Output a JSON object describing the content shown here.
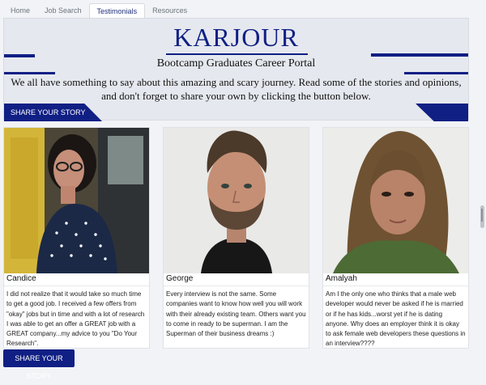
{
  "nav": {
    "tabs": [
      "Home",
      "Job Search",
      "Testimonials",
      "Resources"
    ],
    "active": "Testimonials"
  },
  "hero": {
    "brand": "KARJOUR",
    "subtitle": "Bootcamp Graduates Career Portal",
    "intro": "We all have something to say about this amazing and scary journey. Read some of the stories and opinions, and don't forget to share your own by clicking the button below.",
    "cta_label": "SHARE YOUR STORY"
  },
  "testimonials": [
    {
      "name": "Candice",
      "text": "I did not realize that it would take so much time to get a good job. I received a few offers from \"okay\" jobs but in time and with a lot of research I was able to get an offer a GREAT job with a GREAT company...my advice to you \"Do Your Research\"."
    },
    {
      "name": "George",
      "text": "Every interview is not the same. Some companies want to know how well you will work with their already existing team. Others want you to come in ready to be superman. I am the Superman of their business dreams :)"
    },
    {
      "name": "Amalyah",
      "text": "Am I the only one who thinks that a male web developer would never be asked if he is married or if he has kids...worst yet if he is dating anyone. Why does an employer think it is okay to ask female web developers these questions in an interview????"
    }
  ],
  "footer": {
    "cta_label": "SHARE YOUR STORY"
  },
  "colors": {
    "brand": "#101f84",
    "background": "#f1f3f6"
  }
}
